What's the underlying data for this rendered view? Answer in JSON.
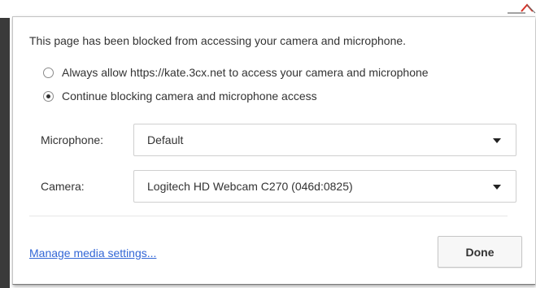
{
  "popup": {
    "message": "This page has been blocked from accessing your camera and microphone.",
    "options": [
      {
        "label": "Always allow https://kate.3cx.net to access your camera and microphone",
        "selected": false
      },
      {
        "label": "Continue blocking camera and microphone access",
        "selected": true
      }
    ],
    "microphone": {
      "label": "Microphone:",
      "value": "Default"
    },
    "camera": {
      "label": "Camera:",
      "value": "Logitech HD Webcam C270 (046d:0825)"
    },
    "manage_link": "Manage media settings...",
    "done_label": "Done"
  },
  "colors": {
    "link": "#3367d6",
    "anchor_icon": "#d93025"
  },
  "icons": {
    "anchor": "camera-blocked-indicator-icon",
    "dropdown": "chevron-down-icon"
  }
}
